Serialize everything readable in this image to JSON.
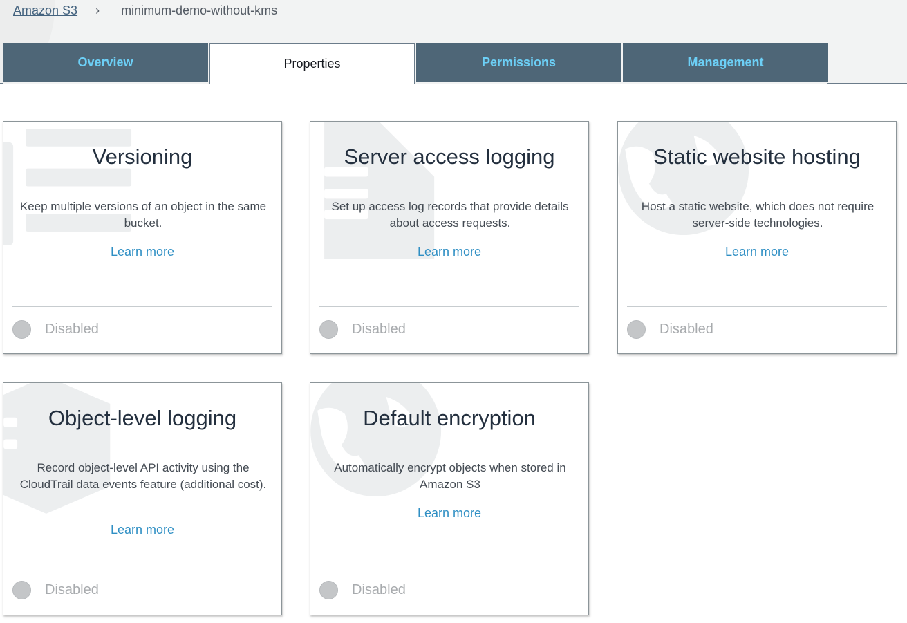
{
  "breadcrumb": {
    "root": "Amazon S3",
    "separator": "›",
    "current": "minimum-demo-without-kms"
  },
  "tabs": [
    {
      "label": "Overview",
      "active": false
    },
    {
      "label": "Properties",
      "active": true
    },
    {
      "label": "Permissions",
      "active": false
    },
    {
      "label": "Management",
      "active": false
    }
  ],
  "cards": [
    {
      "title": "Versioning",
      "description": "Keep multiple versions of an object in the same bucket.",
      "learn_more": "Learn more",
      "status": "Disabled",
      "background_icon": "list-icon"
    },
    {
      "title": "Server access logging",
      "description": "Set up access log records that provide details about access requests.",
      "learn_more": "Learn more",
      "status": "Disabled",
      "background_icon": "log-document-icon"
    },
    {
      "title": "Static website hosting",
      "description": "Host a static website, which does not require server-side technologies.",
      "learn_more": "Learn more",
      "status": "Disabled",
      "background_icon": "globe-icon"
    },
    {
      "title": "Object-level logging",
      "description": "Record object-level API activity using the CloudTrail data events feature (additional cost).",
      "learn_more": "Learn more",
      "status": "Disabled",
      "background_icon": "hexagon-log-icon"
    },
    {
      "title": "Default encryption",
      "description": "Automatically encrypt objects when stored in Amazon S3",
      "learn_more": "Learn more",
      "status": "Disabled",
      "background_icon": "globe-icon"
    }
  ],
  "colors": {
    "tab_bg": "#4e6677",
    "tab_text": "#6ccff6",
    "link": "#2f8fc4",
    "breadcrumb_link": "#44637f",
    "disabled_text": "#a8abae",
    "background_icon": "#eceeef"
  }
}
